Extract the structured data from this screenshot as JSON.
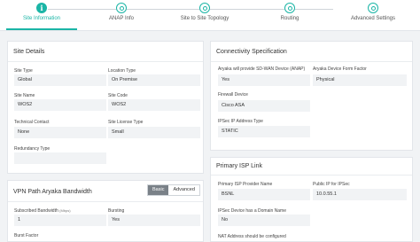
{
  "steps": [
    {
      "label": "Site Information",
      "icon": "info-icon"
    },
    {
      "label": "ANAP Info",
      "icon": "step-dot-icon"
    },
    {
      "label": "Site to Site Topology",
      "icon": "step-dot-icon"
    },
    {
      "label": "Routing",
      "icon": "step-dot-icon"
    },
    {
      "label": "Advanced Settings",
      "icon": "step-dot-icon"
    }
  ],
  "site_details": {
    "title": "Site Details",
    "fields": [
      {
        "label": "Site Type",
        "value": "Global"
      },
      {
        "label": "Location Type",
        "value": "On Premise"
      },
      {
        "label": "Site Name",
        "value": "WOS2"
      },
      {
        "label": "Site Code",
        "value": "WOS2"
      },
      {
        "label": "Technical Contact",
        "value": "None"
      },
      {
        "label": "Site License Type",
        "value": "Small"
      },
      {
        "label": "Redundancy Type",
        "value": ""
      }
    ]
  },
  "vpn": {
    "title": "VPN Path Aryaka Bandwidth",
    "toggle_basic": "Basic",
    "toggle_advanced": "Advanced",
    "subscribed_label": "Subscribed Bandwidth",
    "subscribed_unit": "(Mbps)",
    "subscribed_value": "1",
    "bursting_label": "Bursting",
    "bursting_value": "Yes",
    "cut_label": "Burst Factor"
  },
  "connectivity": {
    "title": "Connectivity Specification",
    "fields": [
      {
        "label": "Aryaka will provide SD-WAN Device (ANAP)",
        "value": "Yes"
      },
      {
        "label": "Aryaka Device Form Factor",
        "value": "Physical"
      },
      {
        "label": "Firewall Device",
        "value": "Cisco ASA"
      },
      {
        "label": "IPSec IP Address Type",
        "value": "STATIC"
      }
    ]
  },
  "primary_isp": {
    "title": "Primary ISP Link",
    "fields": [
      {
        "label": "Primary ISP Provider Name",
        "value": "BSNL"
      },
      {
        "label": "Public IP for IPSec",
        "value": "10.0.55.1"
      },
      {
        "label": "IPSec Device has a Domain Name",
        "value": "No"
      }
    ],
    "cut_label": "NAT Address should be configured"
  },
  "colors": {
    "accent": "#1bb5a6",
    "field_bg": "#f1f3f5",
    "page_bg": "#f1f3f5"
  }
}
